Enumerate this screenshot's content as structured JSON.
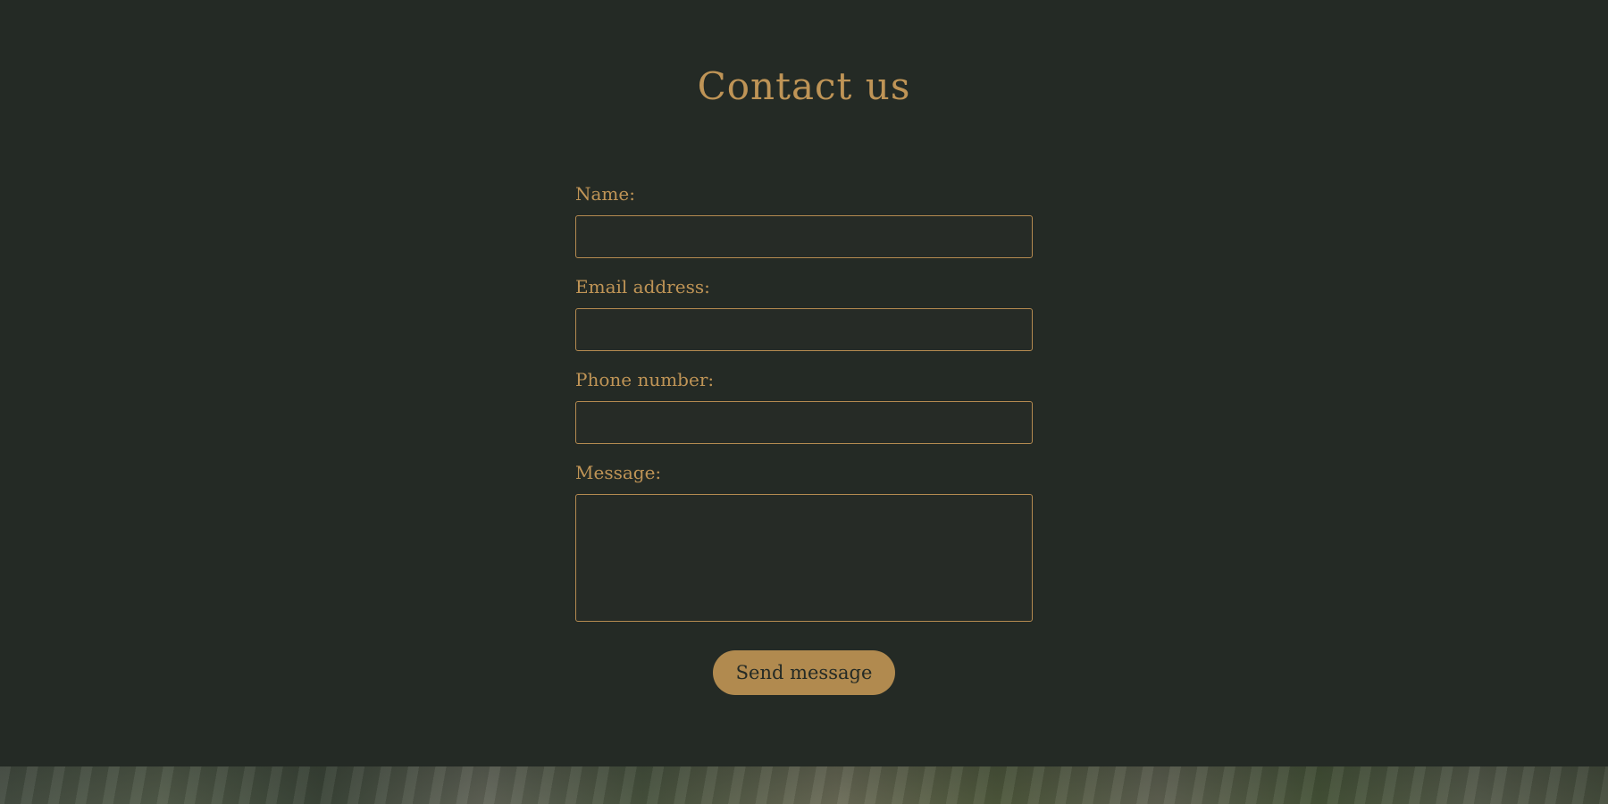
{
  "contact": {
    "title": "Contact us",
    "fields": {
      "name_label": "Name:",
      "name_value": "",
      "email_label": "Email address:",
      "email_value": "",
      "phone_label": "Phone number:",
      "phone_value": "",
      "message_label": "Message:",
      "message_value": ""
    },
    "submit_label": "Send message"
  },
  "colors": {
    "background": "#242a25",
    "accent": "#bf9456",
    "button_bg": "#b18a4f",
    "button_text": "#242a25"
  }
}
